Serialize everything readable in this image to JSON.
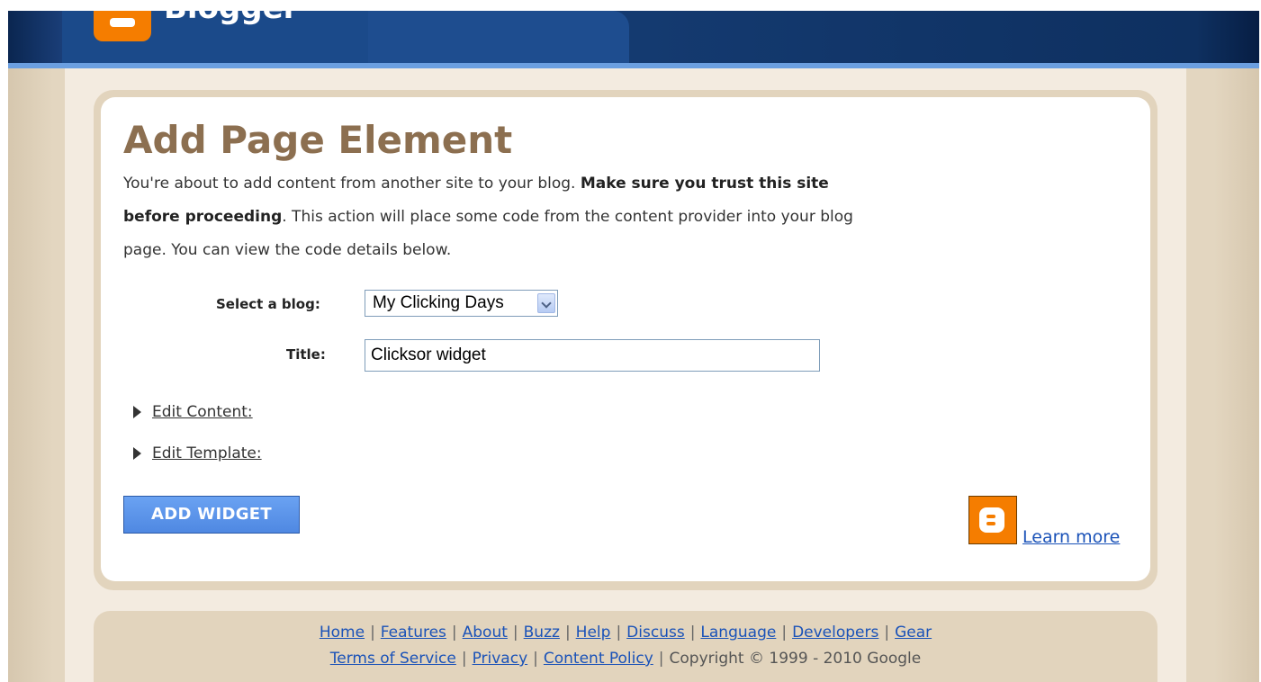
{
  "header": {
    "brand": "Blogger"
  },
  "main": {
    "title": "Add Page Element",
    "intro_part1": "You're about to add content from another site to your blog. ",
    "intro_bold": "Make sure you trust this site before proceeding",
    "intro_part2": ". This action will place some code from the content provider into your blog page. You can view the code details below."
  },
  "form": {
    "select_label": "Select a blog:",
    "select_value": "My Clicking Days",
    "title_label": "Title:",
    "title_value": "Clicksor widget"
  },
  "expanders": {
    "edit_content": "Edit Content:",
    "edit_template": "Edit Template:"
  },
  "actions": {
    "add_widget": "ADD WIDGET",
    "learn_more": "Learn more"
  },
  "footer": {
    "links_row1": [
      "Home",
      "Features",
      "About",
      "Buzz",
      "Help",
      "Discuss",
      "Language",
      "Developers",
      "Gear"
    ],
    "links_row2": [
      "Terms of Service",
      "Privacy",
      "Content Policy"
    ],
    "copyright": "Copyright © 1999 - 2010 Google"
  },
  "colors": {
    "header_blue": "#1c4a8a",
    "title_brown": "#8c6f50",
    "button_blue": "#5b94ea",
    "link_blue": "#1a52b8",
    "blogger_orange": "#f57d00"
  }
}
